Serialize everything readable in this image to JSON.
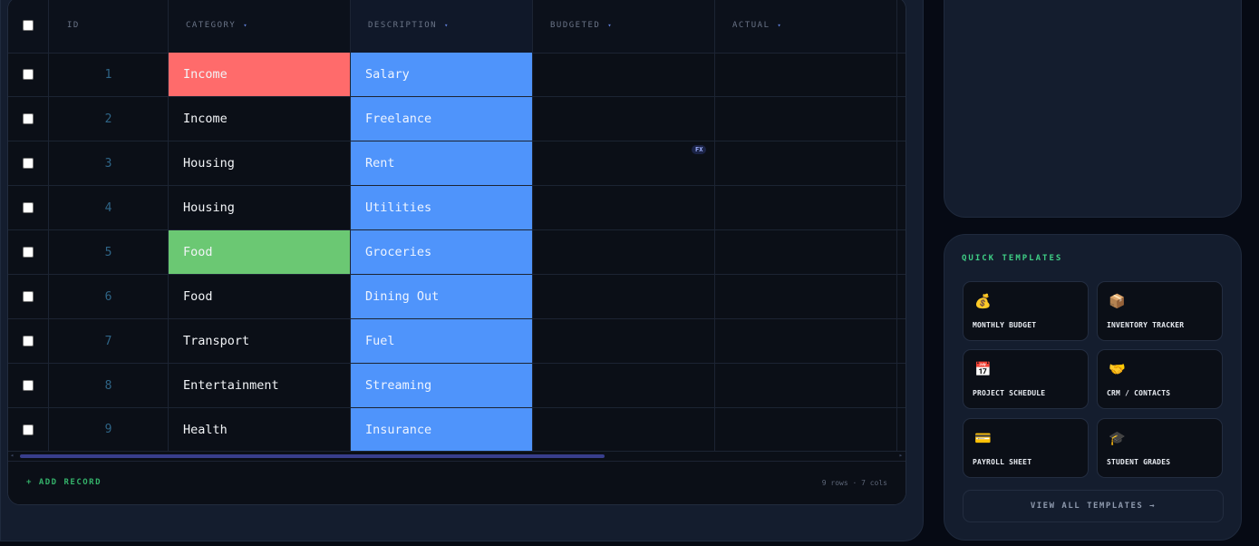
{
  "table": {
    "columns": [
      {
        "label": "ID"
      },
      {
        "label": "CATEGORY"
      },
      {
        "label": "DESCRIPTION"
      },
      {
        "label": "BUDGETED"
      },
      {
        "label": "ACTUAL"
      }
    ],
    "sort_caret": "▾",
    "fx_badge": "FX",
    "rows": [
      {
        "id": "1",
        "category": "Income",
        "description": "Salary"
      },
      {
        "id": "2",
        "category": "Income",
        "description": "Freelance"
      },
      {
        "id": "3",
        "category": "Housing",
        "description": "Rent"
      },
      {
        "id": "4",
        "category": "Housing",
        "description": "Utilities"
      },
      {
        "id": "5",
        "category": "Food",
        "description": "Groceries"
      },
      {
        "id": "6",
        "category": "Food",
        "description": "Dining Out"
      },
      {
        "id": "7",
        "category": "Transport",
        "description": "Fuel"
      },
      {
        "id": "8",
        "category": "Entertainment",
        "description": "Streaming"
      },
      {
        "id": "9",
        "category": "Health",
        "description": "Insurance"
      }
    ],
    "highlight_colors": {
      "income_red": "#ff6b6b",
      "food_green": "#6bc873",
      "description_blue": "#4f94fb"
    }
  },
  "footer": {
    "add_record": "+ ADD RECORD",
    "row_info": "9 rows · 7 cols"
  },
  "quick_templates": {
    "title": "QUICK TEMPLATES",
    "tiles": [
      {
        "icon": "money-bag-icon",
        "glyph": "💰",
        "label": "MONTHLY BUDGET"
      },
      {
        "icon": "package-icon",
        "glyph": "📦",
        "label": "INVENTORY TRACKER"
      },
      {
        "icon": "calendar-icon",
        "glyph": "📅",
        "label": "PROJECT SCHEDULE"
      },
      {
        "icon": "handshake-icon",
        "glyph": "🤝",
        "label": "CRM / CONTACTS"
      },
      {
        "icon": "credit-card-icon",
        "glyph": "💳",
        "label": "PAYROLL SHEET"
      },
      {
        "icon": "graduation-cap-icon",
        "glyph": "🎓",
        "label": "STUDENT GRADES"
      }
    ],
    "view_all": "VIEW ALL TEMPLATES →"
  }
}
